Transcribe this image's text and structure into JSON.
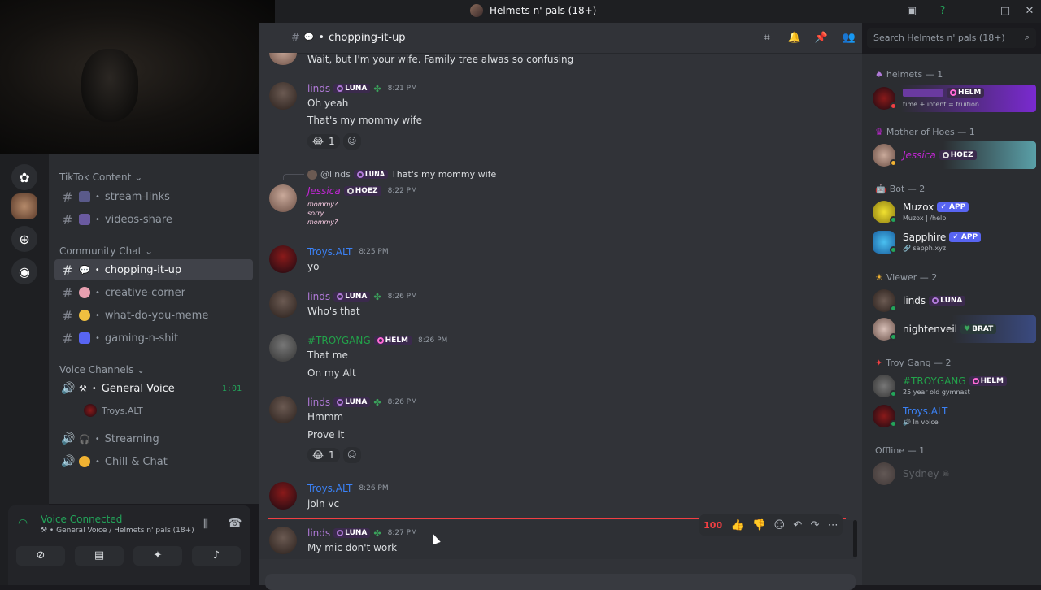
{
  "title_bar": {
    "server_title": "Helmets n' pals (18+)"
  },
  "server_rail": {
    "icons": [
      "discord-logo-icon",
      "server-avatar-icon",
      "add-server-icon",
      "explore-icon"
    ]
  },
  "sidebar": {
    "categories": {
      "tiktok": "TikTok Content",
      "community": "Community Chat",
      "voice": "Voice Channels"
    },
    "tiktok_channels": [
      {
        "label": "stream-links"
      },
      {
        "label": "videos-share"
      }
    ],
    "community_channels": [
      {
        "label": "chopping-it-up",
        "active": true
      },
      {
        "label": "creative-corner"
      },
      {
        "label": "what-do-you-meme"
      },
      {
        "label": "gaming-n-shit"
      }
    ],
    "voice_channels": [
      {
        "label": "General Voice",
        "timer": "1:01",
        "member": "Troys.ALT"
      },
      {
        "label": "Streaming"
      },
      {
        "label": "Chill & Chat"
      }
    ]
  },
  "voice_panel": {
    "status": "Voice Connected",
    "location": "General Voice / Helmets n' pals (18+)"
  },
  "chat_header": {
    "channel": "chopping-it-up"
  },
  "search": {
    "placeholder": "Search Helmets n' pals (18+)"
  },
  "messages": [
    {
      "text": "Wait, but I'm your wife. Family tree alwas so confusing"
    },
    {
      "author": "linds",
      "badge": "LUNA",
      "time": "8:21 PM",
      "lines": [
        "Oh yeah",
        "That's my mommy wife"
      ],
      "reaction_count": "1"
    },
    {
      "reply_to": "@linds",
      "reply_badge": "LUNA",
      "reply_text": "That's my mommy wife",
      "author": "Jessica",
      "badge": "HOEZ",
      "time": "8:22 PM",
      "small_lines": [
        "mommy?",
        "sorry...",
        "mommy?"
      ]
    },
    {
      "author": "Troys.ALT",
      "time": "8:25 PM",
      "lines": [
        "yo"
      ]
    },
    {
      "author": "linds",
      "badge": "LUNA",
      "time": "8:26 PM",
      "lines": [
        "Who's that"
      ]
    },
    {
      "author": "#TROYGANG",
      "badge": "HELM",
      "time": "8:26 PM",
      "lines": [
        "That me",
        "On my Alt"
      ]
    },
    {
      "author": "linds",
      "badge": "LUNA",
      "time": "8:26 PM",
      "lines": [
        "Hmmm",
        "Prove it"
      ],
      "reaction_count": "1"
    },
    {
      "author": "Troys.ALT",
      "time": "8:26 PM",
      "lines": [
        "join vc"
      ]
    },
    {
      "author": "linds",
      "badge": "LUNA",
      "time": "8:27 PM",
      "lines": [
        "My mic don't work"
      ]
    }
  ],
  "members": {
    "groups": [
      {
        "label": "helmets — 1"
      },
      {
        "label": "Mother of Hoes — 1"
      },
      {
        "label": "Bot — 2"
      },
      {
        "label": "Viewer — 2"
      },
      {
        "label": "Troy Gang — 2"
      },
      {
        "label": "Offline — 1"
      }
    ],
    "people": [
      {
        "name": "",
        "badge": "HELM",
        "sub": "time + intent = fruition"
      },
      {
        "name": "Jessica",
        "badge": "HOEZ"
      },
      {
        "name": "Muzox",
        "badge": "APP",
        "sub": "Muzox | /help"
      },
      {
        "name": "Sapphire",
        "badge": "APP",
        "sub": "sapph.xyz"
      },
      {
        "name": "linds",
        "badge": "LUNA"
      },
      {
        "name": "nightenveil",
        "badge": "BRAT"
      },
      {
        "name": "#TROYGANG",
        "badge": "HELM",
        "sub": "25 year old gymnast"
      },
      {
        "name": "Troys.ALT",
        "sub": "In voice"
      },
      {
        "name": "Sydney"
      }
    ]
  },
  "colors": {
    "linds": "#b07ad8",
    "jessica": "#c026d3",
    "troys": "#3b82f6",
    "troygang": "#22a34a",
    "online": "#23a55a",
    "mention_line": "#f23f43"
  }
}
